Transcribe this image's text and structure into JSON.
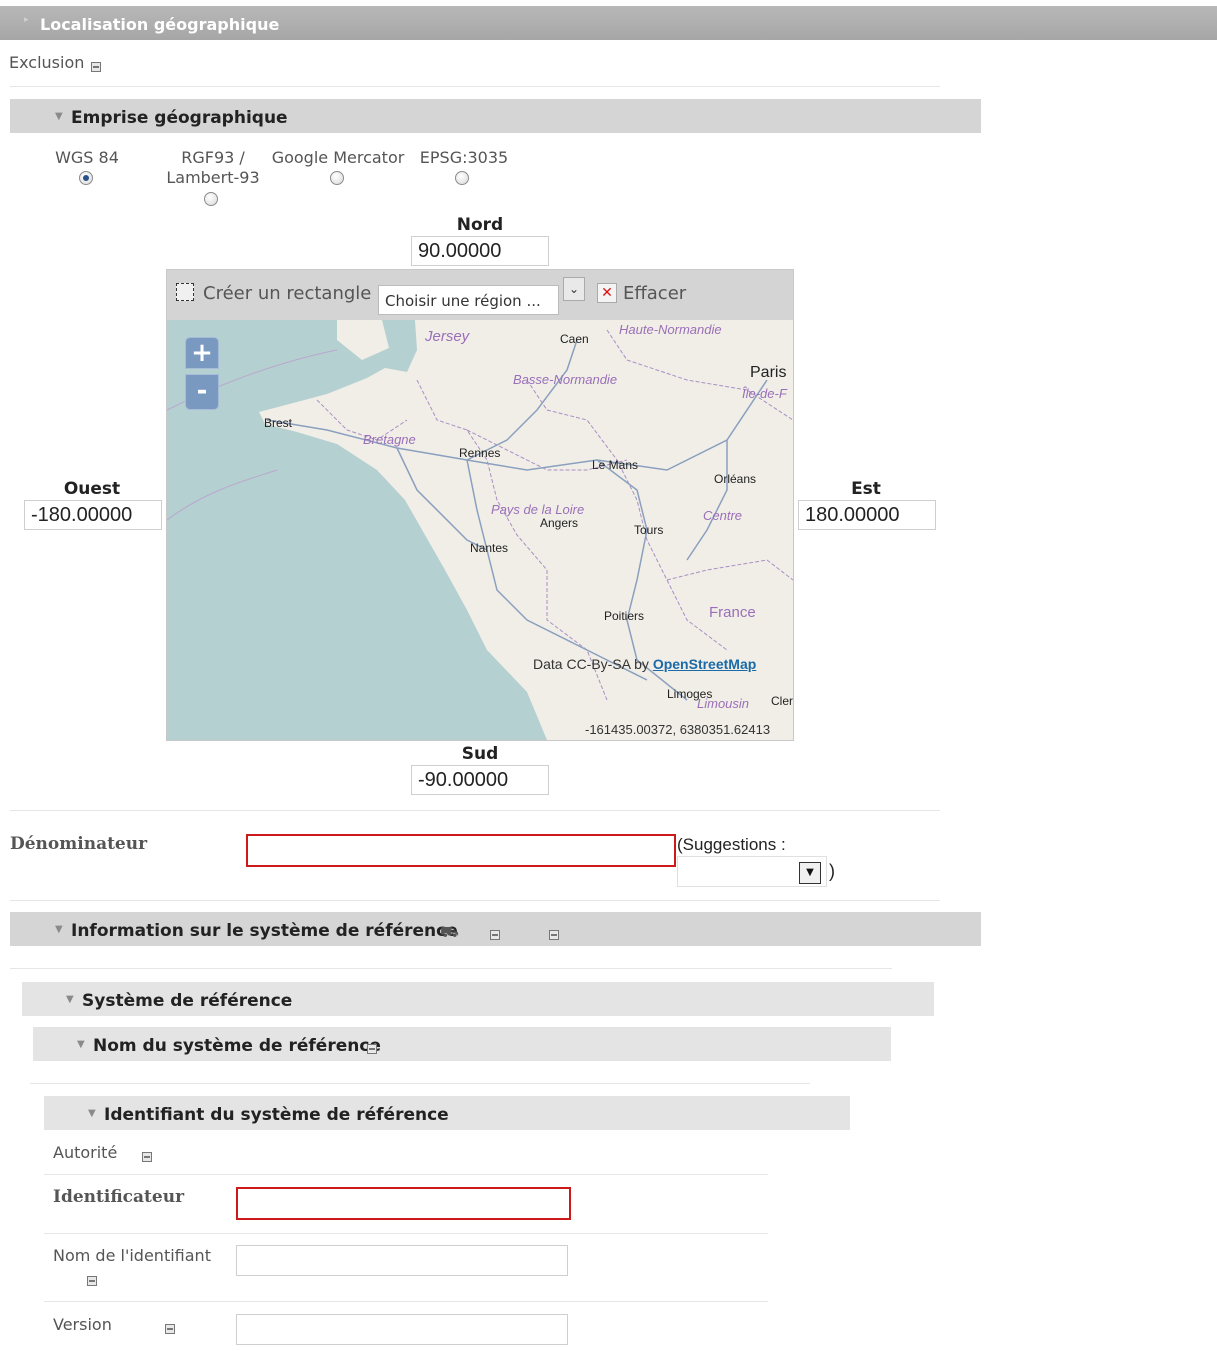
{
  "header": {
    "title": "Localisation géographique"
  },
  "exclusion": {
    "label": "Exclusion"
  },
  "emprise": {
    "title": "Emprise géographique",
    "projections": [
      {
        "label": "WGS 84",
        "selected": true
      },
      {
        "label": "RGF93 / Lambert-93",
        "selected": false
      },
      {
        "label": "Google Mercator",
        "selected": false
      },
      {
        "label": "EPSG:3035",
        "selected": false
      }
    ],
    "nord_label": "Nord",
    "nord_value": "90.00000",
    "sud_label": "Sud",
    "sud_value": "-90.00000",
    "ouest_label": "Ouest",
    "ouest_value": "-180.00000",
    "est_label": "Est",
    "est_value": "180.00000",
    "toolbar": {
      "rectangle_label": "Créer un rectangle",
      "region_select": "Choisir une région ...",
      "clear_label": "Effacer"
    },
    "map": {
      "zoom_in": "+",
      "zoom_out": "-",
      "attribution_prefix": "Data CC-By-SA by",
      "attribution_link": "OpenStreetMap",
      "coordinates": "-161435.00372, 6380351.62413",
      "cities": [
        "Caen",
        "Paris",
        "Brest",
        "Rennes",
        "Le Mans",
        "Orléans",
        "Angers",
        "Tours",
        "Nantes",
        "Poitiers",
        "Limoges",
        "Cler"
      ],
      "regions": [
        "Jersey",
        "Haute-Normandie",
        "Basse-Normandie",
        "Île-de-F",
        "Bretagne",
        "Pays de la Loire",
        "Centre",
        "France",
        "Limousin"
      ]
    }
  },
  "denominateur": {
    "label": "Dénominateur",
    "value": "",
    "suggestions_label": "(Suggestions :",
    "suggestions_close": ")"
  },
  "systeme": {
    "info_title": "Information sur le système de référence",
    "systeme_title": "Système de référence",
    "nom_title": "Nom du système de référence",
    "identifiant_title": "Identifiant du système de référence",
    "autorite_label": "Autorité",
    "identificateur_label": "Identificateur",
    "nom_identifiant_label": "Nom de l'identifiant",
    "version_label": "Version"
  }
}
